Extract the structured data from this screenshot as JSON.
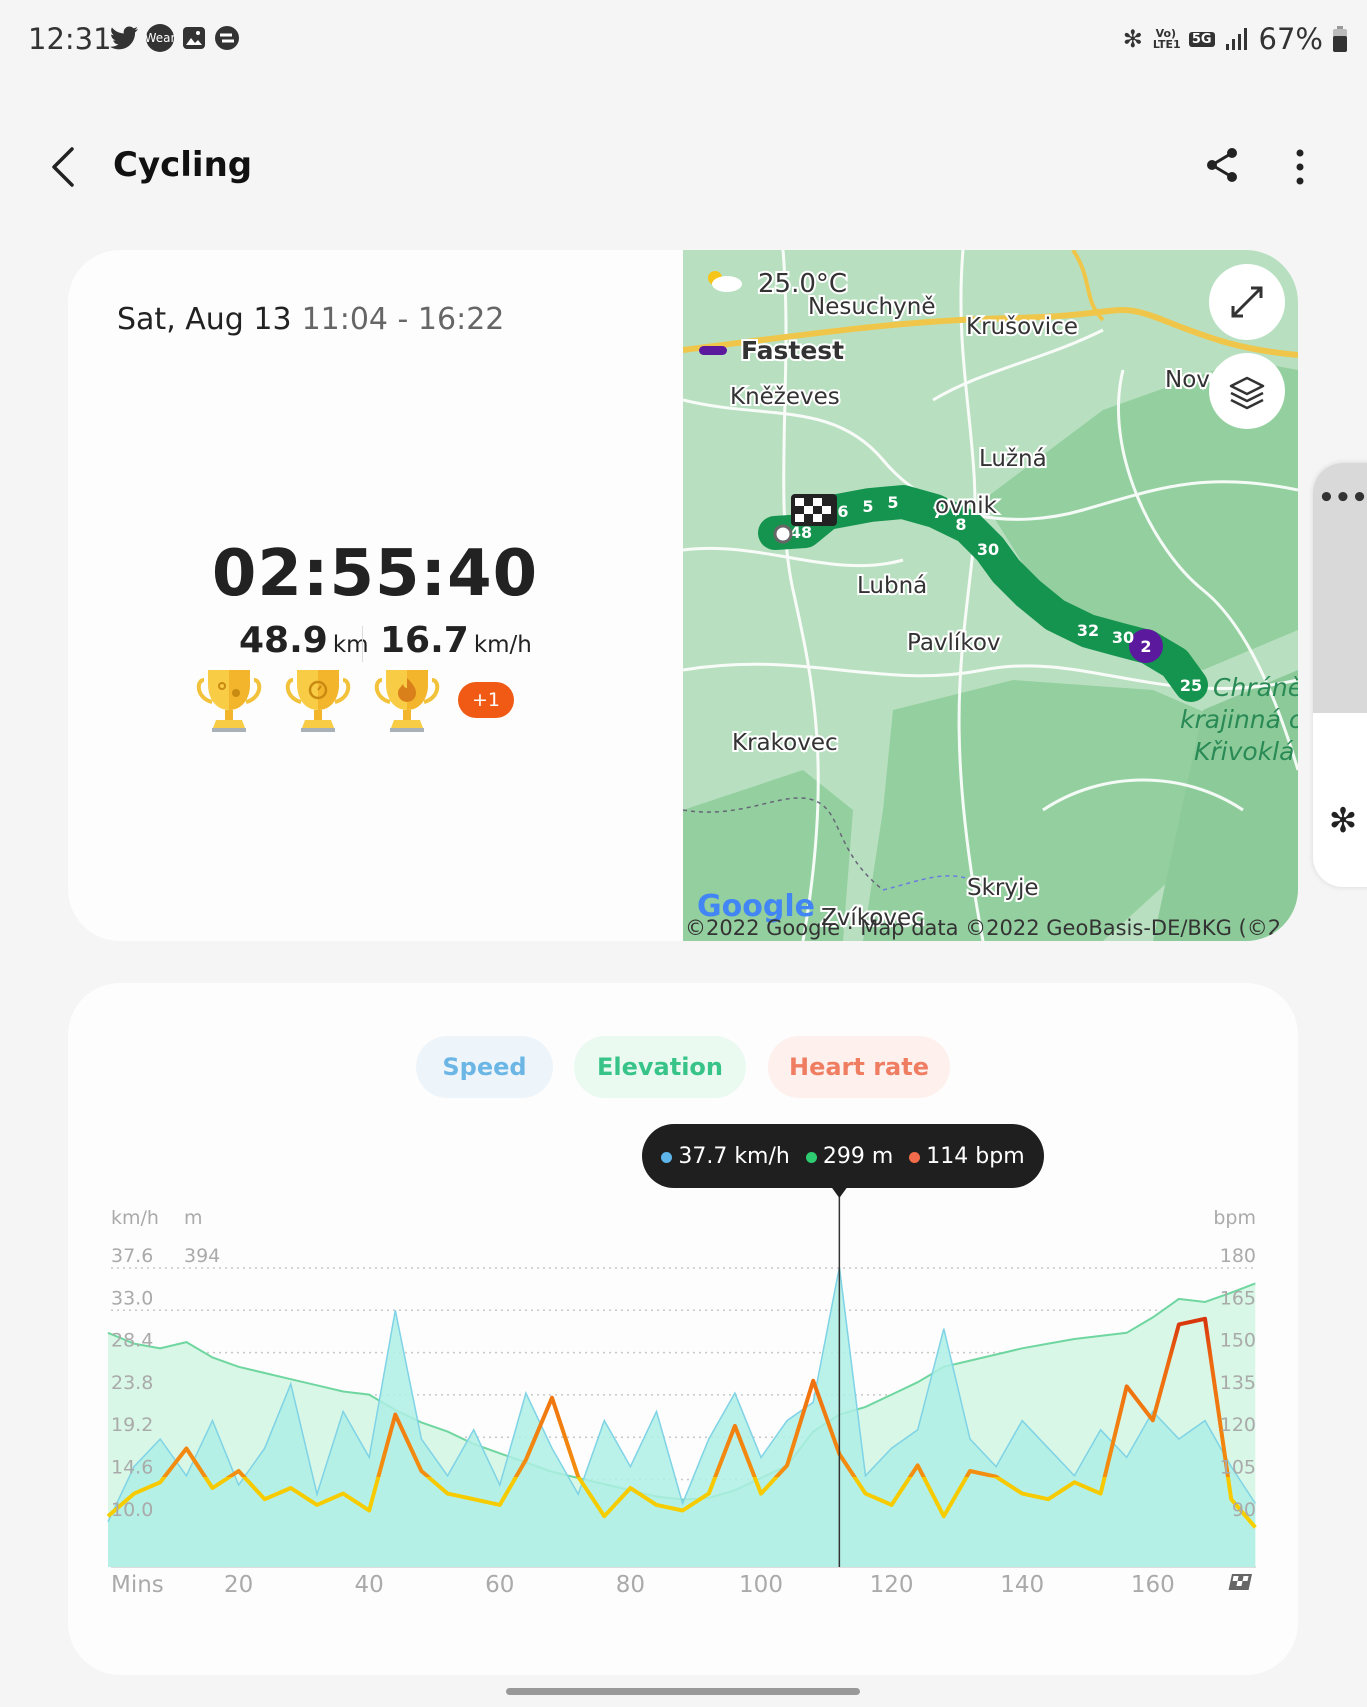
{
  "status_bar": {
    "time": "12:31",
    "notification_icons": [
      "twitter-icon",
      "wear-icon",
      "gallery-icon",
      "sync-app-icon"
    ],
    "wear_label": "Wear",
    "volte_label": "Vo) LTE1",
    "network_label": "5G",
    "battery_percent": "67%"
  },
  "header": {
    "title": "Cycling",
    "back_icon": "chevron-left-icon",
    "share_icon": "share-icon",
    "more_icon": "more-vertical-icon"
  },
  "summary": {
    "date": "Sat, Aug 13",
    "time_range": "11:04 - 16:22",
    "duration": "02:55:40",
    "distance_value": "48.9",
    "distance_unit": "km",
    "speed_value": "16.7",
    "speed_unit": "km/h",
    "trophies": [
      "distance-trophy-icon",
      "duration-trophy-icon",
      "calories-trophy-icon"
    ],
    "more_trophies": "+1"
  },
  "map": {
    "weather": "25.0°C",
    "legend_fastest": "Fastest",
    "places": [
      "Nesuchyně",
      "Krušovice",
      "Kněževes",
      "Nové",
      "Lužná",
      "ovnik",
      "Lubná",
      "Pavlíkov",
      "Krakovec",
      "Skryje",
      "Zvíkovec"
    ],
    "park_label": [
      "Chráně",
      "krajinná o",
      "Křivoklá"
    ],
    "route_markers": [
      "48",
      "6",
      "5",
      "5",
      "7",
      "8",
      "30",
      "32",
      "30",
      "2",
      "25"
    ],
    "logo": "Google",
    "copyright": "©2022 Google · Map data ©2022 GeoBasis-DE/BKG (©2",
    "colors": {
      "route": "#15944f",
      "fastest": "#5b1a9e"
    }
  },
  "chart_tabs": [
    {
      "label": "Speed",
      "color": "#6cb6e6"
    },
    {
      "label": "Elevation",
      "color": "#38c488"
    },
    {
      "label": "Heart rate",
      "color": "#ef7d62"
    }
  ],
  "tooltip": {
    "speed": "37.7 km/h",
    "elevation": "299 m",
    "heart_rate": "114 bpm"
  },
  "chart_data": {
    "type": "line",
    "xlabel": "Mins",
    "x_ticks": [
      20,
      40,
      60,
      80,
      100,
      120,
      140,
      160
    ],
    "x": [
      0,
      4,
      8,
      12,
      16,
      20,
      24,
      28,
      32,
      36,
      40,
      44,
      48,
      52,
      56,
      60,
      64,
      68,
      72,
      76,
      80,
      84,
      88,
      92,
      96,
      100,
      104,
      108,
      112,
      116,
      120,
      124,
      128,
      132,
      136,
      140,
      144,
      148,
      152,
      156,
      160,
      164,
      168,
      172,
      175.7
    ],
    "cursor_x": 112,
    "axes": {
      "speed": {
        "unit": "km/h",
        "ticks": [
          "37.6",
          "33.0",
          "28.4",
          "23.8",
          "19.2",
          "14.6",
          "10.0"
        ]
      },
      "elevation": {
        "unit": "m",
        "ticks": [
          "394"
        ]
      },
      "heart_rate": {
        "unit": "bpm",
        "ticks": [
          "180",
          "165",
          "150",
          "135",
          "120",
          "105",
          "90"
        ]
      }
    },
    "grid": true,
    "series": [
      {
        "name": "Speed",
        "unit": "km/h",
        "color": "#7fd3e6",
        "values": [
          10,
          16,
          19,
          15,
          21,
          14,
          18,
          25,
          13,
          22,
          17,
          33,
          19,
          15,
          20,
          14,
          24,
          18,
          13,
          21,
          16,
          22,
          12,
          19,
          24,
          17,
          21,
          23,
          37.7,
          15,
          18,
          20,
          31,
          19,
          16,
          21,
          18,
          15,
          20,
          17,
          22,
          19,
          21,
          16,
          12
        ]
      },
      {
        "name": "Elevation",
        "unit": "m",
        "color": "#6fd6a0",
        "values": [
          352,
          345,
          342,
          346,
          336,
          330,
          326,
          322,
          318,
          314,
          312,
          302,
          294,
          288,
          280,
          274,
          268,
          262,
          258,
          254,
          250,
          246,
          244,
          245,
          250,
          258,
          266,
          288,
          299,
          304,
          312,
          320,
          330,
          334,
          338,
          342,
          345,
          348,
          350,
          352,
          362,
          374,
          372,
          378,
          384
        ]
      },
      {
        "name": "Heart rate",
        "unit": "bpm",
        "color": "#f5c400",
        "values": [
          92,
          100,
          104,
          116,
          102,
          108,
          98,
          102,
          96,
          100,
          94,
          128,
          108,
          100,
          98,
          96,
          112,
          134,
          106,
          92,
          102,
          96,
          94,
          100,
          124,
          100,
          110,
          140,
          114,
          100,
          96,
          110,
          92,
          108,
          106,
          100,
          98,
          104,
          100,
          138,
          126,
          160,
          162,
          98,
          88
        ]
      }
    ]
  }
}
